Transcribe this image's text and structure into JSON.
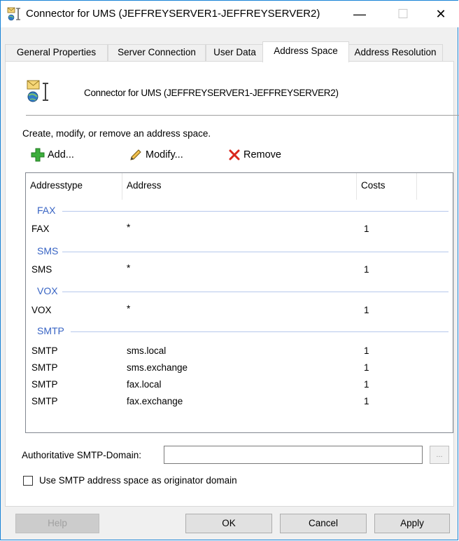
{
  "window": {
    "title": "Connector for UMS (JEFFREYSERVER1-JEFFREYSERVER2)",
    "controls": {
      "minimize": "—",
      "maximize": "☐",
      "close": "✕"
    }
  },
  "tabs": [
    {
      "label": "General Properties",
      "active": false
    },
    {
      "label": "Server Connection",
      "active": false
    },
    {
      "label": "User Data",
      "active": false
    },
    {
      "label": "Address Space",
      "active": true
    },
    {
      "label": "Address Resolution",
      "active": false
    }
  ],
  "header": {
    "title": "Connector for UMS (JEFFREYSERVER1-JEFFREYSERVER2)",
    "icon": "connector-icon"
  },
  "instructions": "Create, modify, or remove an address space.",
  "toolbar": {
    "add_label": "Add...",
    "modify_label": "Modify...",
    "remove_label": "Remove"
  },
  "list": {
    "columns": [
      "Addresstype",
      "Address",
      "Costs"
    ],
    "groups": [
      {
        "name": "FAX",
        "rows": [
          [
            "FAX",
            "*",
            "1"
          ]
        ]
      },
      {
        "name": "SMS",
        "rows": [
          [
            "SMS",
            "*",
            "1"
          ]
        ]
      },
      {
        "name": "VOX",
        "rows": [
          [
            "VOX",
            "*",
            "1"
          ]
        ]
      },
      {
        "name": "SMTP",
        "rows": [
          [
            "SMTP",
            "sms.local",
            "1"
          ],
          [
            "SMTP",
            "sms.exchange",
            "1"
          ],
          [
            "SMTP",
            "fax.local",
            "1"
          ],
          [
            "SMTP",
            "fax.exchange",
            "1"
          ]
        ]
      }
    ]
  },
  "auth_domain": {
    "label": "Authoritative SMTP-Domain:",
    "value": "",
    "browse_label": "..."
  },
  "originator_checkbox": {
    "label": "Use SMTP address space as originator domain",
    "checked": false
  },
  "buttons": {
    "help": "Help",
    "ok": "OK",
    "cancel": "Cancel",
    "apply": "Apply"
  },
  "colors": {
    "accent_border": "#1883d7",
    "group_header": "#3864c4",
    "remove_red": "#d9261c",
    "add_green": "#3cae3c"
  }
}
